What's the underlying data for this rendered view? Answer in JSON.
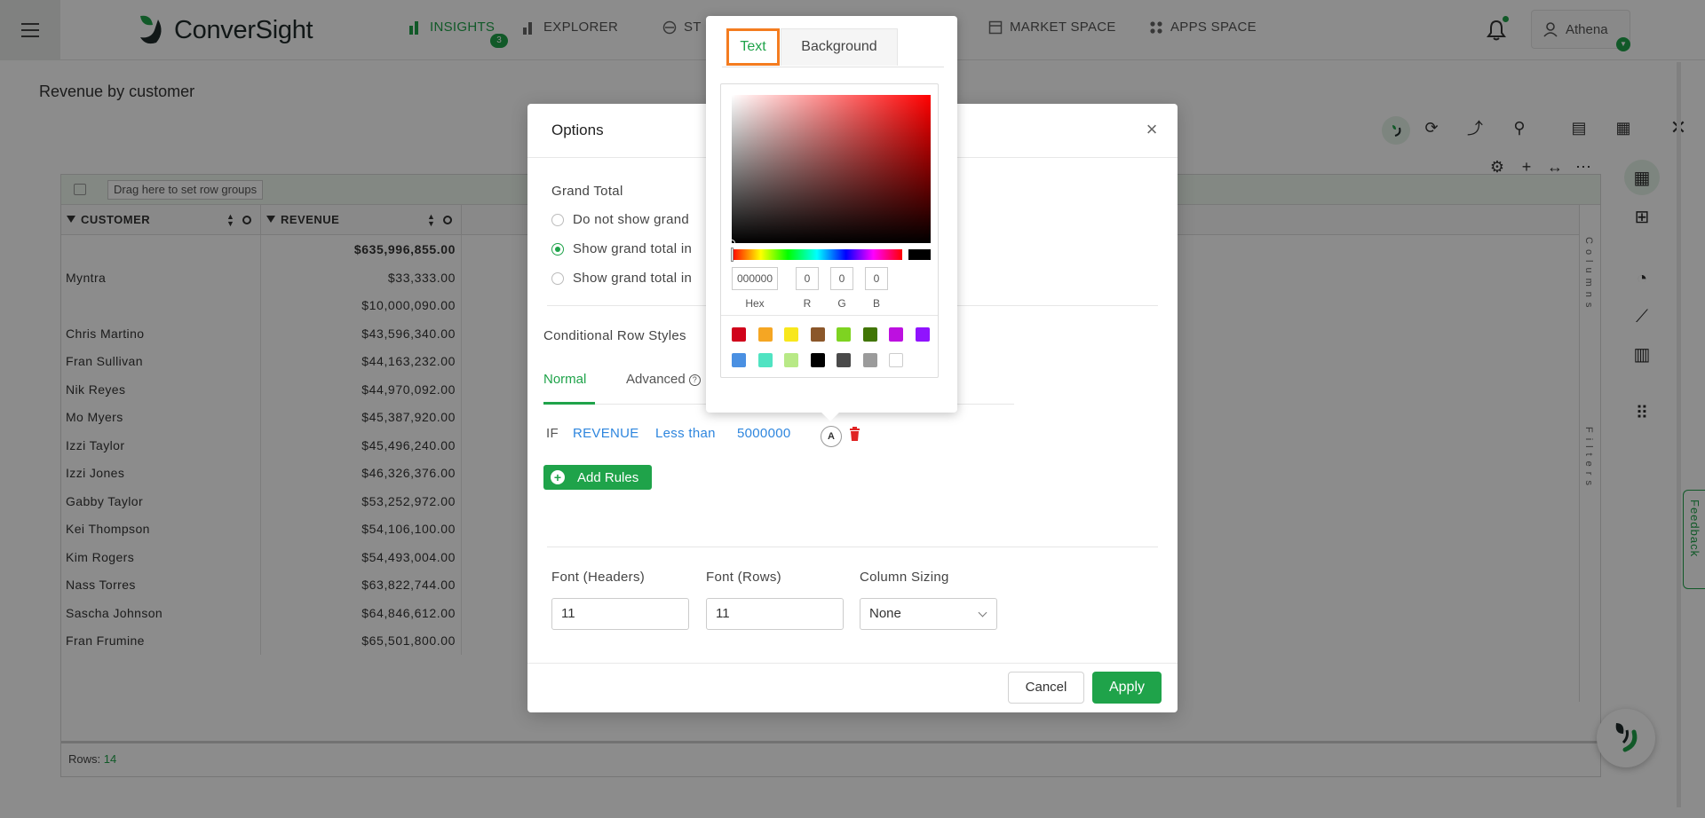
{
  "app": {
    "brand": "ConverSight"
  },
  "nav": [
    {
      "label": "INSIGHTS",
      "icon": "bar-chart-icon",
      "active": true,
      "badge": "3"
    },
    {
      "label": "EXPLORER",
      "icon": "bar-chart-icon",
      "active": false
    },
    {
      "label": "ST",
      "icon": "storyboard-icon",
      "active": false
    },
    {
      "label": "MARKET SPACE",
      "icon": "market-space-icon",
      "active": false
    },
    {
      "label": "APPS SPACE",
      "icon": "apps-grid-icon",
      "active": false
    }
  ],
  "user": {
    "name": "Athena"
  },
  "page": {
    "title": "Revenue by customer"
  },
  "grid": {
    "row_group_hint": "Drag here to set row groups",
    "columns": [
      "CUSTOMER",
      "REVENUE"
    ],
    "grand_total": "$635,996,855.00",
    "rows": [
      {
        "customer": "Myntra",
        "revenue": "$33,333.00"
      },
      {
        "customer": "",
        "revenue": "$10,000,090.00"
      },
      {
        "customer": "Chris Martino",
        "revenue": "$43,596,340.00"
      },
      {
        "customer": "Fran Sullivan",
        "revenue": "$44,163,232.00"
      },
      {
        "customer": "Nik Reyes",
        "revenue": "$44,970,092.00"
      },
      {
        "customer": "Mo Myers",
        "revenue": "$45,387,920.00"
      },
      {
        "customer": "Izzi Taylor",
        "revenue": "$45,496,240.00"
      },
      {
        "customer": "Izzi Jones",
        "revenue": "$46,326,376.00"
      },
      {
        "customer": "Gabby Taylor",
        "revenue": "$53,252,972.00"
      },
      {
        "customer": "Kei Thompson",
        "revenue": "$54,106,100.00"
      },
      {
        "customer": "Kim Rogers",
        "revenue": "$54,493,004.00"
      },
      {
        "customer": "Nass Torres",
        "revenue": "$63,822,744.00"
      },
      {
        "customer": "Sascha Johnson",
        "revenue": "$64,846,612.00"
      },
      {
        "customer": "Fran Frumine",
        "revenue": "$65,501,800.00"
      }
    ],
    "footer_label": "Rows:",
    "footer_count": "14",
    "side_columns": "Columns",
    "side_filters": "Filters"
  },
  "feedback": "Feedback",
  "options_modal": {
    "title": "Options",
    "grand_total_label": "Grand Total",
    "grand_total_options": [
      {
        "label": "Do not show grand",
        "selected": false
      },
      {
        "label": "Show grand total in",
        "selected": true
      },
      {
        "label": "Show grand total in",
        "selected": false
      }
    ],
    "conditional_label": "Conditional Row Styles",
    "tabs": [
      "Normal",
      "Advanced"
    ],
    "rule": {
      "if": "IF",
      "field": "REVENUE",
      "op": "Less than",
      "value": "5000000",
      "style_badge": "A"
    },
    "add_rules": "Add Rules",
    "font_headers_label": "Font (Headers)",
    "font_headers_value": "11",
    "font_rows_label": "Font (Rows)",
    "font_rows_value": "11",
    "column_sizing_label": "Column Sizing",
    "column_sizing_value": "None",
    "cancel": "Cancel",
    "apply": "Apply"
  },
  "color_picker": {
    "tabs": [
      "Text",
      "Background"
    ],
    "hex": "000000",
    "r": "0",
    "g": "0",
    "b": "0",
    "labels": {
      "hex": "Hex",
      "r": "R",
      "g": "G",
      "b": "B"
    },
    "swatches": [
      "#d0021b",
      "#f5a623",
      "#f8e71c",
      "#8b572a",
      "#7ed321",
      "#417505",
      "#bd10e0",
      "#9013fe",
      "#4a90e2",
      "#50e3c2",
      "#b8e986",
      "#000000",
      "#4a4a4a",
      "#9b9b9b",
      "#ffffff"
    ],
    "accent_color": "#1fa34a",
    "highlight_color": "#f47c20"
  }
}
